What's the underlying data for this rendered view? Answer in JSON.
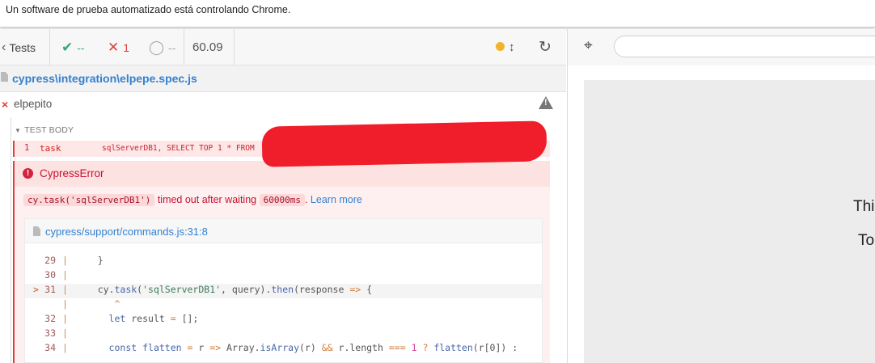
{
  "infobar": {
    "text": "Un software de prueba automatizado está controlando Chrome."
  },
  "reporter": {
    "tests_label": "Tests",
    "passed": "--",
    "failed": "1",
    "pending": "--",
    "duration": "60.09",
    "spec_path": "cypress\\integration\\elpepe.spec.js",
    "suite_title": "elpepito",
    "test_body_label": "TEST BODY",
    "command": {
      "number": "1",
      "name": "task",
      "message": "sqlServerDB1, SELECT TOP 1 * FROM "
    },
    "error": {
      "name": "CypressError",
      "code_call": "cy.task('sqlServerDB1')",
      "text_mid": "timed out after waiting",
      "timeout_value": "60000ms",
      "text_end": ".",
      "learn_more": "Learn more",
      "file_link": "cypress/support/commands.js:31:8"
    }
  },
  "code_lines": [
    {
      "arrow": "",
      "num": "29",
      "src": "    }"
    },
    {
      "arrow": "",
      "num": "30",
      "src": ""
    },
    {
      "arrow": ">",
      "num": "31",
      "src": "    cy.task('sqlServerDB1', query).then(response => {"
    },
    {
      "arrow": "",
      "num": "",
      "src": "       ^"
    },
    {
      "arrow": "",
      "num": "32",
      "src": "      let result = [];"
    },
    {
      "arrow": "",
      "num": "33",
      "src": ""
    },
    {
      "arrow": "",
      "num": "34",
      "src": "      const flatten = r => Array.isArray(r) && r.length === 1 ? flatten(r[0]) :"
    }
  ],
  "aut": {
    "line1": "Thi",
    "line2": "To"
  },
  "colors": {
    "passed": "#3aa873",
    "failed": "#e0403a",
    "running_dot": "#f2b32a",
    "link": "#3380d0",
    "error_text": "#c8102e"
  },
  "icons": {
    "back": "chevron-left-icon",
    "pass": "check-icon",
    "fail": "x-icon",
    "pending": "circle-notch-icon",
    "autoscroll": "arrows-v-icon",
    "reload": "redo-icon",
    "selector": "crosshair-icon",
    "warning": "warning-icon",
    "file": "file-icon",
    "error": "exclamation-circle-icon"
  }
}
